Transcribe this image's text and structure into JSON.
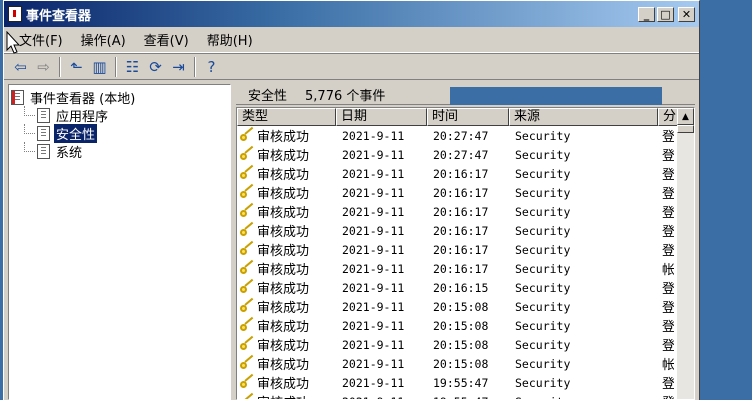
{
  "window": {
    "title": "事件查看器"
  },
  "menu": [
    "文件(F)",
    "操作(A)",
    "查看(V)",
    "帮助(H)"
  ],
  "toolbar": {
    "back_icon": "arrow-left-icon",
    "forward_icon": "arrow-right-icon",
    "up_icon": "up-folder-icon",
    "show_hide_icon": "show-hide-tree-icon",
    "properties_icon": "properties-icon",
    "refresh_icon": "refresh-icon",
    "export_icon": "export-list-icon",
    "help_icon": "help-icon"
  },
  "tree": {
    "root": "事件查看器 (本地)",
    "children": [
      "应用程序",
      "安全性",
      "系统"
    ],
    "selected": "安全性"
  },
  "pane": {
    "title": "安全性",
    "count": "5,776 个事件"
  },
  "columns": [
    "类型",
    "日期",
    "时间",
    "来源",
    "分"
  ],
  "rows": [
    {
      "type": "审核成功",
      "date": "2021-9-11",
      "time": "20:27:47",
      "source": "Security",
      "cat": "登"
    },
    {
      "type": "审核成功",
      "date": "2021-9-11",
      "time": "20:27:47",
      "source": "Security",
      "cat": "登"
    },
    {
      "type": "审核成功",
      "date": "2021-9-11",
      "time": "20:16:17",
      "source": "Security",
      "cat": "登"
    },
    {
      "type": "审核成功",
      "date": "2021-9-11",
      "time": "20:16:17",
      "source": "Security",
      "cat": "登"
    },
    {
      "type": "审核成功",
      "date": "2021-9-11",
      "time": "20:16:17",
      "source": "Security",
      "cat": "登"
    },
    {
      "type": "审核成功",
      "date": "2021-9-11",
      "time": "20:16:17",
      "source": "Security",
      "cat": "登"
    },
    {
      "type": "审核成功",
      "date": "2021-9-11",
      "time": "20:16:17",
      "source": "Security",
      "cat": "登"
    },
    {
      "type": "审核成功",
      "date": "2021-9-11",
      "time": "20:16:17",
      "source": "Security",
      "cat": "帐"
    },
    {
      "type": "审核成功",
      "date": "2021-9-11",
      "time": "20:16:15",
      "source": "Security",
      "cat": "登"
    },
    {
      "type": "审核成功",
      "date": "2021-9-11",
      "time": "20:15:08",
      "source": "Security",
      "cat": "登"
    },
    {
      "type": "审核成功",
      "date": "2021-9-11",
      "time": "20:15:08",
      "source": "Security",
      "cat": "登"
    },
    {
      "type": "审核成功",
      "date": "2021-9-11",
      "time": "20:15:08",
      "source": "Security",
      "cat": "登"
    },
    {
      "type": "审核成功",
      "date": "2021-9-11",
      "time": "20:15:08",
      "source": "Security",
      "cat": "帐"
    },
    {
      "type": "审核成功",
      "date": "2021-9-11",
      "time": "19:55:47",
      "source": "Security",
      "cat": "登"
    },
    {
      "type": "审核成功",
      "date": "2021-9-11",
      "time": "19:55:47",
      "source": "Security",
      "cat": "登"
    }
  ]
}
